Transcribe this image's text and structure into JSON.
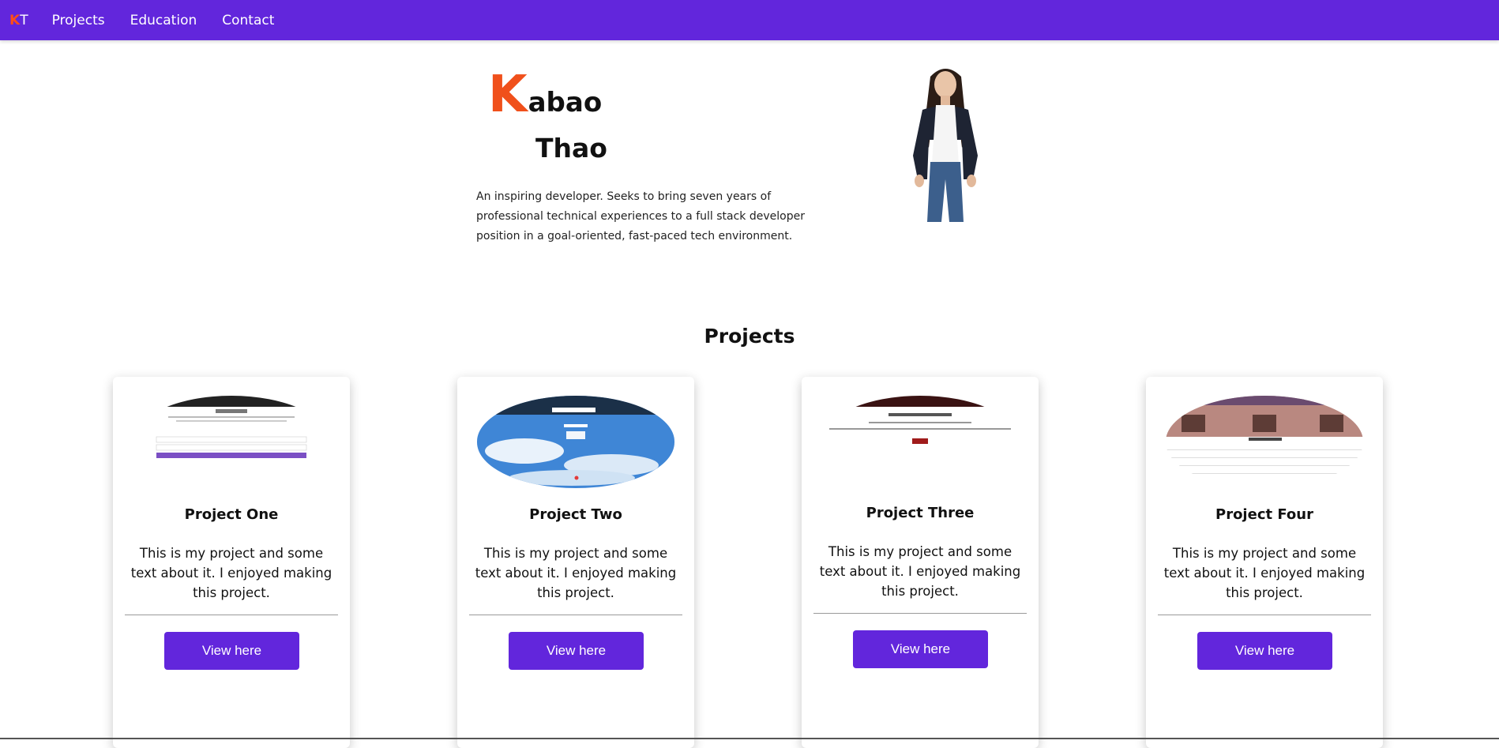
{
  "nav": {
    "brand_k": "K",
    "brand_t": "T",
    "links": [
      "Projects",
      "Education",
      "Contact"
    ]
  },
  "hero": {
    "first_initial": "K",
    "first_rest": "abao",
    "last_name": "Thao",
    "bio": "An inspiring developer. Seeks to bring seven years of professional technical experiences to a full stack developer position in a goal-oriented, fast-paced tech environment."
  },
  "projects": {
    "title": "Projects",
    "cards": [
      {
        "title": "Project One",
        "description": "This is my project and some text about it. I enjoyed making this project.",
        "button": "View here"
      },
      {
        "title": "Project Two",
        "description": "This is my project and some text about it. I enjoyed making this project.",
        "button": "View here"
      },
      {
        "title": "Project Three",
        "description": "This is my project and some text about it. I enjoyed making this project.",
        "button": "View here"
      },
      {
        "title": "Project Four",
        "description": "This is my project and some text about it. I enjoyed making this project.",
        "button": "View here"
      }
    ]
  },
  "colors": {
    "nav_bg": "#6226dc",
    "accent_orange": "#f0501b",
    "button_bg": "#6226dc"
  }
}
